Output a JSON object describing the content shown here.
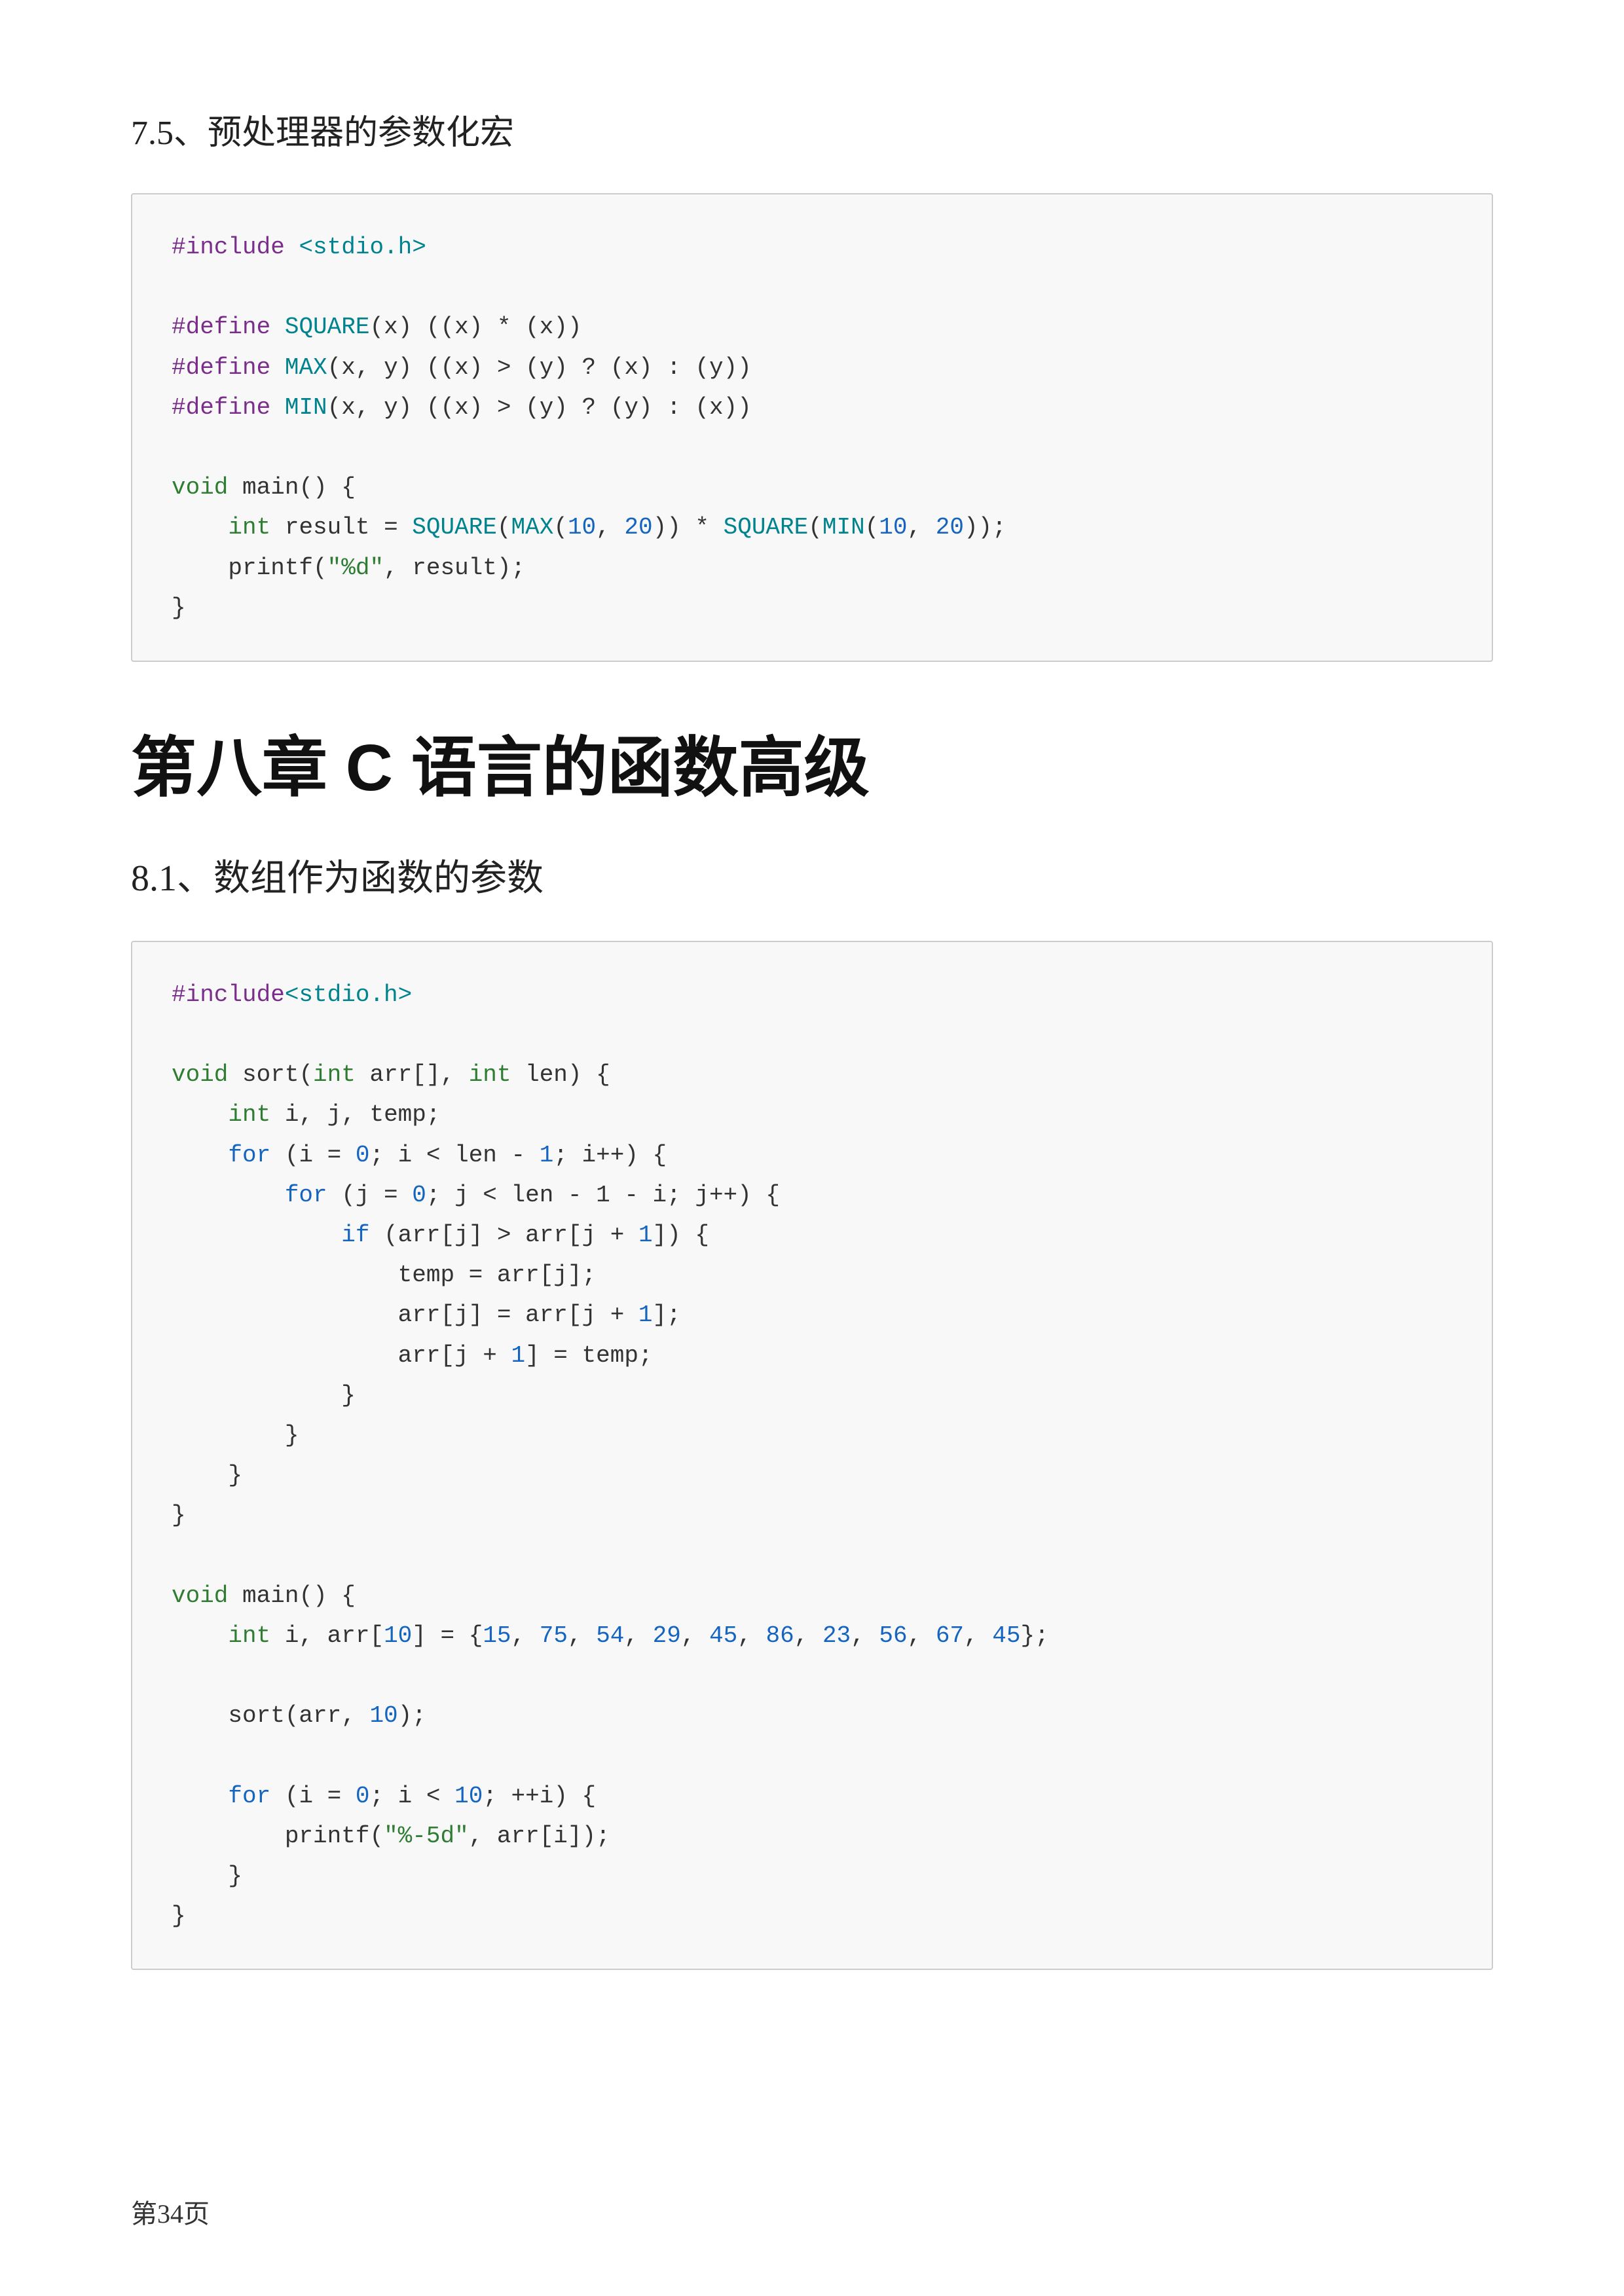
{
  "page": {
    "footer": "第34页"
  },
  "section75": {
    "title": "7.5、预处理器的参数化宏"
  },
  "chapter8": {
    "title": "第八章  C 语言的函数高级"
  },
  "section81": {
    "title": "8.1、数组作为函数的参数"
  }
}
